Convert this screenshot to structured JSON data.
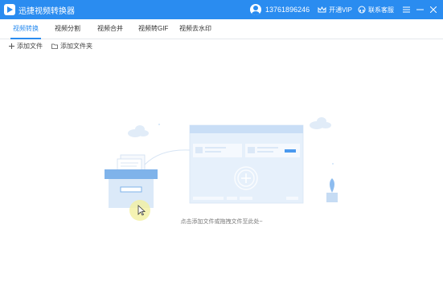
{
  "app": {
    "title": "迅捷视频转换器"
  },
  "user": {
    "phone": "13761896246"
  },
  "header": {
    "vip_label": "开通VIP",
    "service_label": "联系客服"
  },
  "tabs": [
    {
      "label": "视频转换",
      "active": true
    },
    {
      "label": "视频分割",
      "active": false
    },
    {
      "label": "视频合并",
      "active": false
    },
    {
      "label": "视频转GIF",
      "active": false
    },
    {
      "label": "视频去水印",
      "active": false
    }
  ],
  "toolbar": {
    "add_file": "添加文件",
    "add_folder": "添加文件夹"
  },
  "empty_state": {
    "hint": "点击添加文件或拖拽文件至此处~"
  },
  "icons": [
    "app-logo-icon",
    "avatar-icon",
    "crown-icon",
    "headset-icon",
    "menu-icon",
    "minimize-icon",
    "close-icon",
    "plus-icon",
    "folder-icon",
    "cursor-icon"
  ],
  "colors": {
    "accent": "#2a8cf0",
    "illustration": "#cfe3f8",
    "cursor_highlight": "#f3f0a0"
  }
}
